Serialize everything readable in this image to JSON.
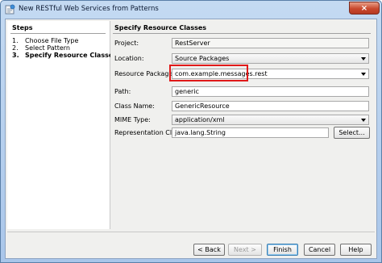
{
  "window": {
    "title": "New RESTful Web Services from Patterns",
    "close_glyph": "×"
  },
  "steps": {
    "heading": "Steps",
    "items": [
      {
        "num": "1.",
        "label": "Choose File Type"
      },
      {
        "num": "2.",
        "label": "Select Pattern"
      },
      {
        "num": "3.",
        "label": "Specify Resource Classes"
      }
    ],
    "active_index": 2
  },
  "panel": {
    "heading": "Specify Resource Classes",
    "project": {
      "label": "Project:",
      "value": "RestServer"
    },
    "location": {
      "label": "Location:",
      "value": "Source Packages"
    },
    "resource_package": {
      "label": "Resource Package:",
      "value": "com.example.messages.rest"
    },
    "path": {
      "label": "Path:",
      "value": "generic"
    },
    "class_name": {
      "label": "Class Name:",
      "value": "GenericResource"
    },
    "mime_type": {
      "label": "MIME Type:",
      "value": "application/xml"
    },
    "representation_class": {
      "label": "Representation Class:",
      "value": "java.lang.String"
    },
    "select_button": "Select..."
  },
  "buttons": {
    "back": "< Back",
    "next": "Next >",
    "finish": "Finish",
    "cancel": "Cancel",
    "help": "Help"
  },
  "colors": {
    "highlight": "#e01919",
    "title_bar": "#a9c6ea",
    "close_button": "#c9492e"
  }
}
